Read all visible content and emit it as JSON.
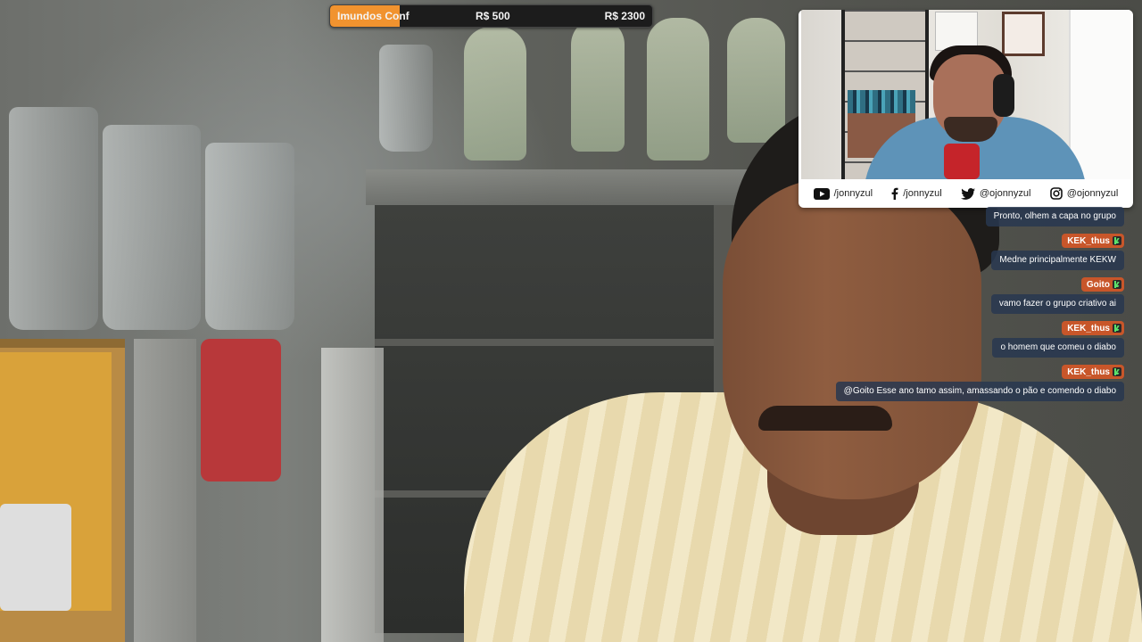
{
  "goal_bar": {
    "title": "Imundos Conf",
    "current": "R$ 500",
    "target": "R$ 2300",
    "progress_fraction": 0.217,
    "fill_color": "#f1932f"
  },
  "webcam": {
    "socials": [
      {
        "icon": "youtube-icon",
        "handle": "/jonnyzul"
      },
      {
        "icon": "facebook-icon",
        "handle": "/jonnyzul"
      },
      {
        "icon": "twitter-icon",
        "handle": "@ojonnyzul"
      },
      {
        "icon": "instagram-icon",
        "handle": "@ojonnyzul"
      }
    ]
  },
  "chat": {
    "name_color": "#c8562a",
    "badge_icon": "kick-badge-icon",
    "messages": [
      {
        "user": "",
        "text": "Pronto, olhem a capa no grupo"
      },
      {
        "user": "KEK_thus",
        "text": "Medne principalmente KEKW"
      },
      {
        "user": "Goito",
        "text": "vamo fazer o grupo criativo ai"
      },
      {
        "user": "KEK_thus",
        "text": "o homem que comeu o diabo"
      },
      {
        "user": "KEK_thus",
        "text": "@Goito Esse ano tamo assim, amassando o pão e comendo o diabo"
      }
    ]
  }
}
